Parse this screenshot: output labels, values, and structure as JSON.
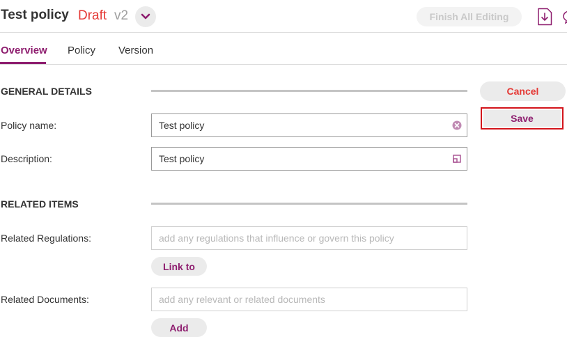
{
  "header": {
    "title": "Test policy",
    "status": "Draft",
    "version": "v2",
    "finish_all_editing_label": "Finish All Editing"
  },
  "tabs": [
    {
      "label": "Overview",
      "active": true
    },
    {
      "label": "Policy",
      "active": false
    },
    {
      "label": "Version",
      "active": false
    }
  ],
  "general_details": {
    "heading": "GENERAL DETAILS",
    "policy_name": {
      "label": "Policy name:",
      "value": "Test policy"
    },
    "description": {
      "label": "Description:",
      "value": "Test policy"
    }
  },
  "related_items": {
    "heading": "RELATED ITEMS",
    "regulations": {
      "label": "Related Regulations:",
      "placeholder": "add any regulations that influence or govern this policy",
      "button_label": "Link to"
    },
    "documents": {
      "label": "Related Documents:",
      "placeholder": "add any relevant or related documents",
      "button_label": "Add"
    }
  },
  "actions": {
    "cancel_label": "Cancel",
    "save_label": "Save"
  },
  "icons": {
    "version_menu": "chevron-down-icon",
    "download": "download-icon",
    "comments": "comment-icon",
    "clear": "clear-icon",
    "expand": "expand-icon"
  },
  "colors": {
    "brand": "#8e1e6f",
    "status_draft": "#e53935",
    "cancel": "#e53935",
    "save_highlight": "#d3141b"
  }
}
